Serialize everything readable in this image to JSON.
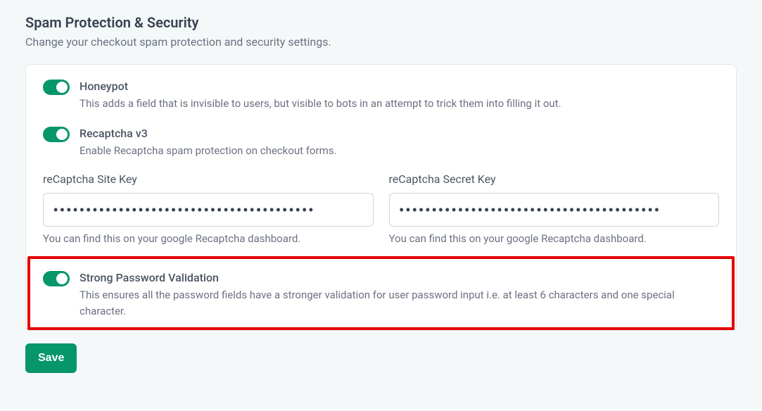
{
  "header": {
    "title": "Spam Protection & Security",
    "description": "Change your checkout spam protection and security settings."
  },
  "options": {
    "honeypot": {
      "title": "Honeypot",
      "description": "This adds a field that is invisible to users, but visible to bots in an attempt to trick them into filling it out."
    },
    "recaptcha": {
      "title": "Recaptcha v3",
      "description": "Enable Recaptcha spam protection on checkout forms."
    },
    "strongPassword": {
      "title": "Strong Password Validation",
      "description": "This ensures all the password fields have a stronger validation for user password input i.e. at least 6 characters and one special character."
    }
  },
  "fields": {
    "siteKey": {
      "label": "reCaptcha Site Key",
      "value": "••••••••••••••••••••••••••••••••••••••••",
      "help": "You can find this on your google Recaptcha dashboard."
    },
    "secretKey": {
      "label": "reCaptcha Secret Key",
      "value": "••••••••••••••••••••••••••••••••••••••••",
      "help": "You can find this on your google Recaptcha dashboard."
    }
  },
  "buttons": {
    "save": "Save"
  }
}
